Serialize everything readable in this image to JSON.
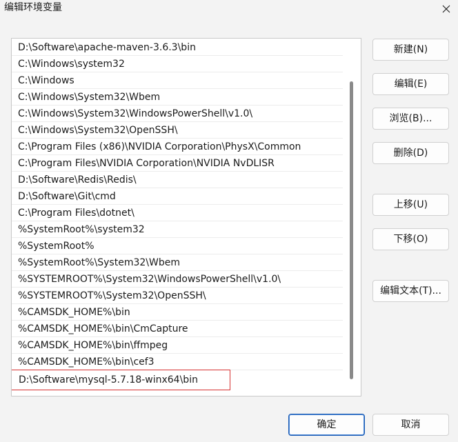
{
  "window": {
    "title": "编辑环境变量",
    "close_icon": "close-icon"
  },
  "path_list": {
    "items": [
      "D:\\Software\\apache-maven-3.6.3\\bin",
      "C:\\Windows\\system32",
      "C:\\Windows",
      "C:\\Windows\\System32\\Wbem",
      "C:\\Windows\\System32\\WindowsPowerShell\\v1.0\\",
      "C:\\Windows\\System32\\OpenSSH\\",
      "C:\\Program Files (x86)\\NVIDIA Corporation\\PhysX\\Common",
      "C:\\Program Files\\NVIDIA Corporation\\NVIDIA NvDLISR",
      "D:\\Software\\Redis\\Redis\\",
      "D:\\Software\\Git\\cmd",
      "C:\\Program Files\\dotnet\\",
      "%SystemRoot%\\system32",
      "%SystemRoot%",
      "%SystemRoot%\\System32\\Wbem",
      "%SYSTEMROOT%\\System32\\WindowsPowerShell\\v1.0\\",
      "%SYSTEMROOT%\\System32\\OpenSSH\\",
      "%CAMSDK_HOME%\\bin",
      "%CAMSDK_HOME%\\bin\\CmCapture",
      "%CAMSDK_HOME%\\bin\\ffmpeg",
      "%CAMSDK_HOME%\\bin\\cef3",
      "D:\\Software\\mysql-5.7.18-winx64\\bin"
    ],
    "highlighted_index": 20,
    "highlight_color": "#d62e2e"
  },
  "side_buttons": {
    "new_label": "新建(N)",
    "edit_label": "编辑(E)",
    "browse_label": "浏览(B)...",
    "delete_label": "删除(D)",
    "move_up_label": "上移(U)",
    "move_down_label": "下移(O)",
    "edit_text_label": "编辑文本(T)..."
  },
  "footer": {
    "ok_label": "确定",
    "cancel_label": "取消",
    "ok_border_color": "#1a5bb5"
  }
}
